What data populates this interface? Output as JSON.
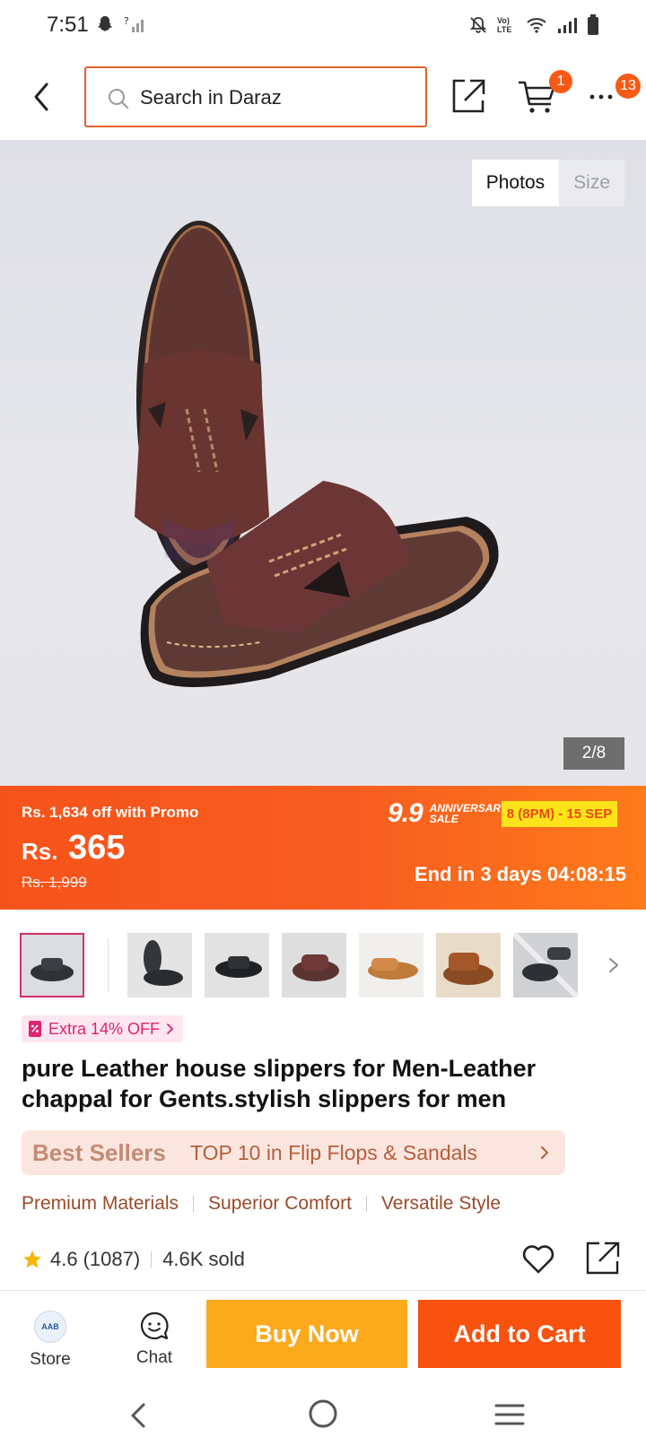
{
  "status_bar": {
    "time": "7:51",
    "volte_label": "Vo) LTE"
  },
  "header": {
    "search_placeholder": "Search in Daraz",
    "cart_badge": "1",
    "more_badge": "13"
  },
  "gallery": {
    "tabs": [
      "Photos",
      "Size"
    ],
    "active_tab": "Photos",
    "counter": "2/8",
    "thumbnail_count": 7
  },
  "promo": {
    "promo_off": "Rs. 1,634 off with Promo",
    "currency": "Rs.",
    "price": "365",
    "original_price": "Rs. 1,999",
    "campaign_number": "9.9",
    "campaign_label": "ANNIVERSARY SALE",
    "campaign_dates": "8 (8PM) - 15 SEP",
    "countdown": "End in 3 days 04:08:15"
  },
  "product": {
    "voucher": "Extra 14% OFF",
    "title": "pure Leather house slippers for Men-Leather chappal for Gents.stylish slippers for men",
    "best_sellers_logo": "Best Sellers",
    "best_sellers_text": "TOP 10 in Flip Flops & Sandals",
    "features": [
      "Premium Materials",
      "Superior Comfort",
      "Versatile Style"
    ],
    "rating": "4.6",
    "review_count": "(1087)",
    "sold": "4.6K sold"
  },
  "action_bar": {
    "store_label": "Store",
    "store_logo_text": "AAB",
    "chat_label": "Chat",
    "buy_now": "Buy Now",
    "add_to_cart": "Add to Cart"
  },
  "colors": {
    "brand_orange": "#f8520e",
    "buy_now_yellow": "#fbaa1c",
    "campaign_yellow": "#ffe31a"
  }
}
